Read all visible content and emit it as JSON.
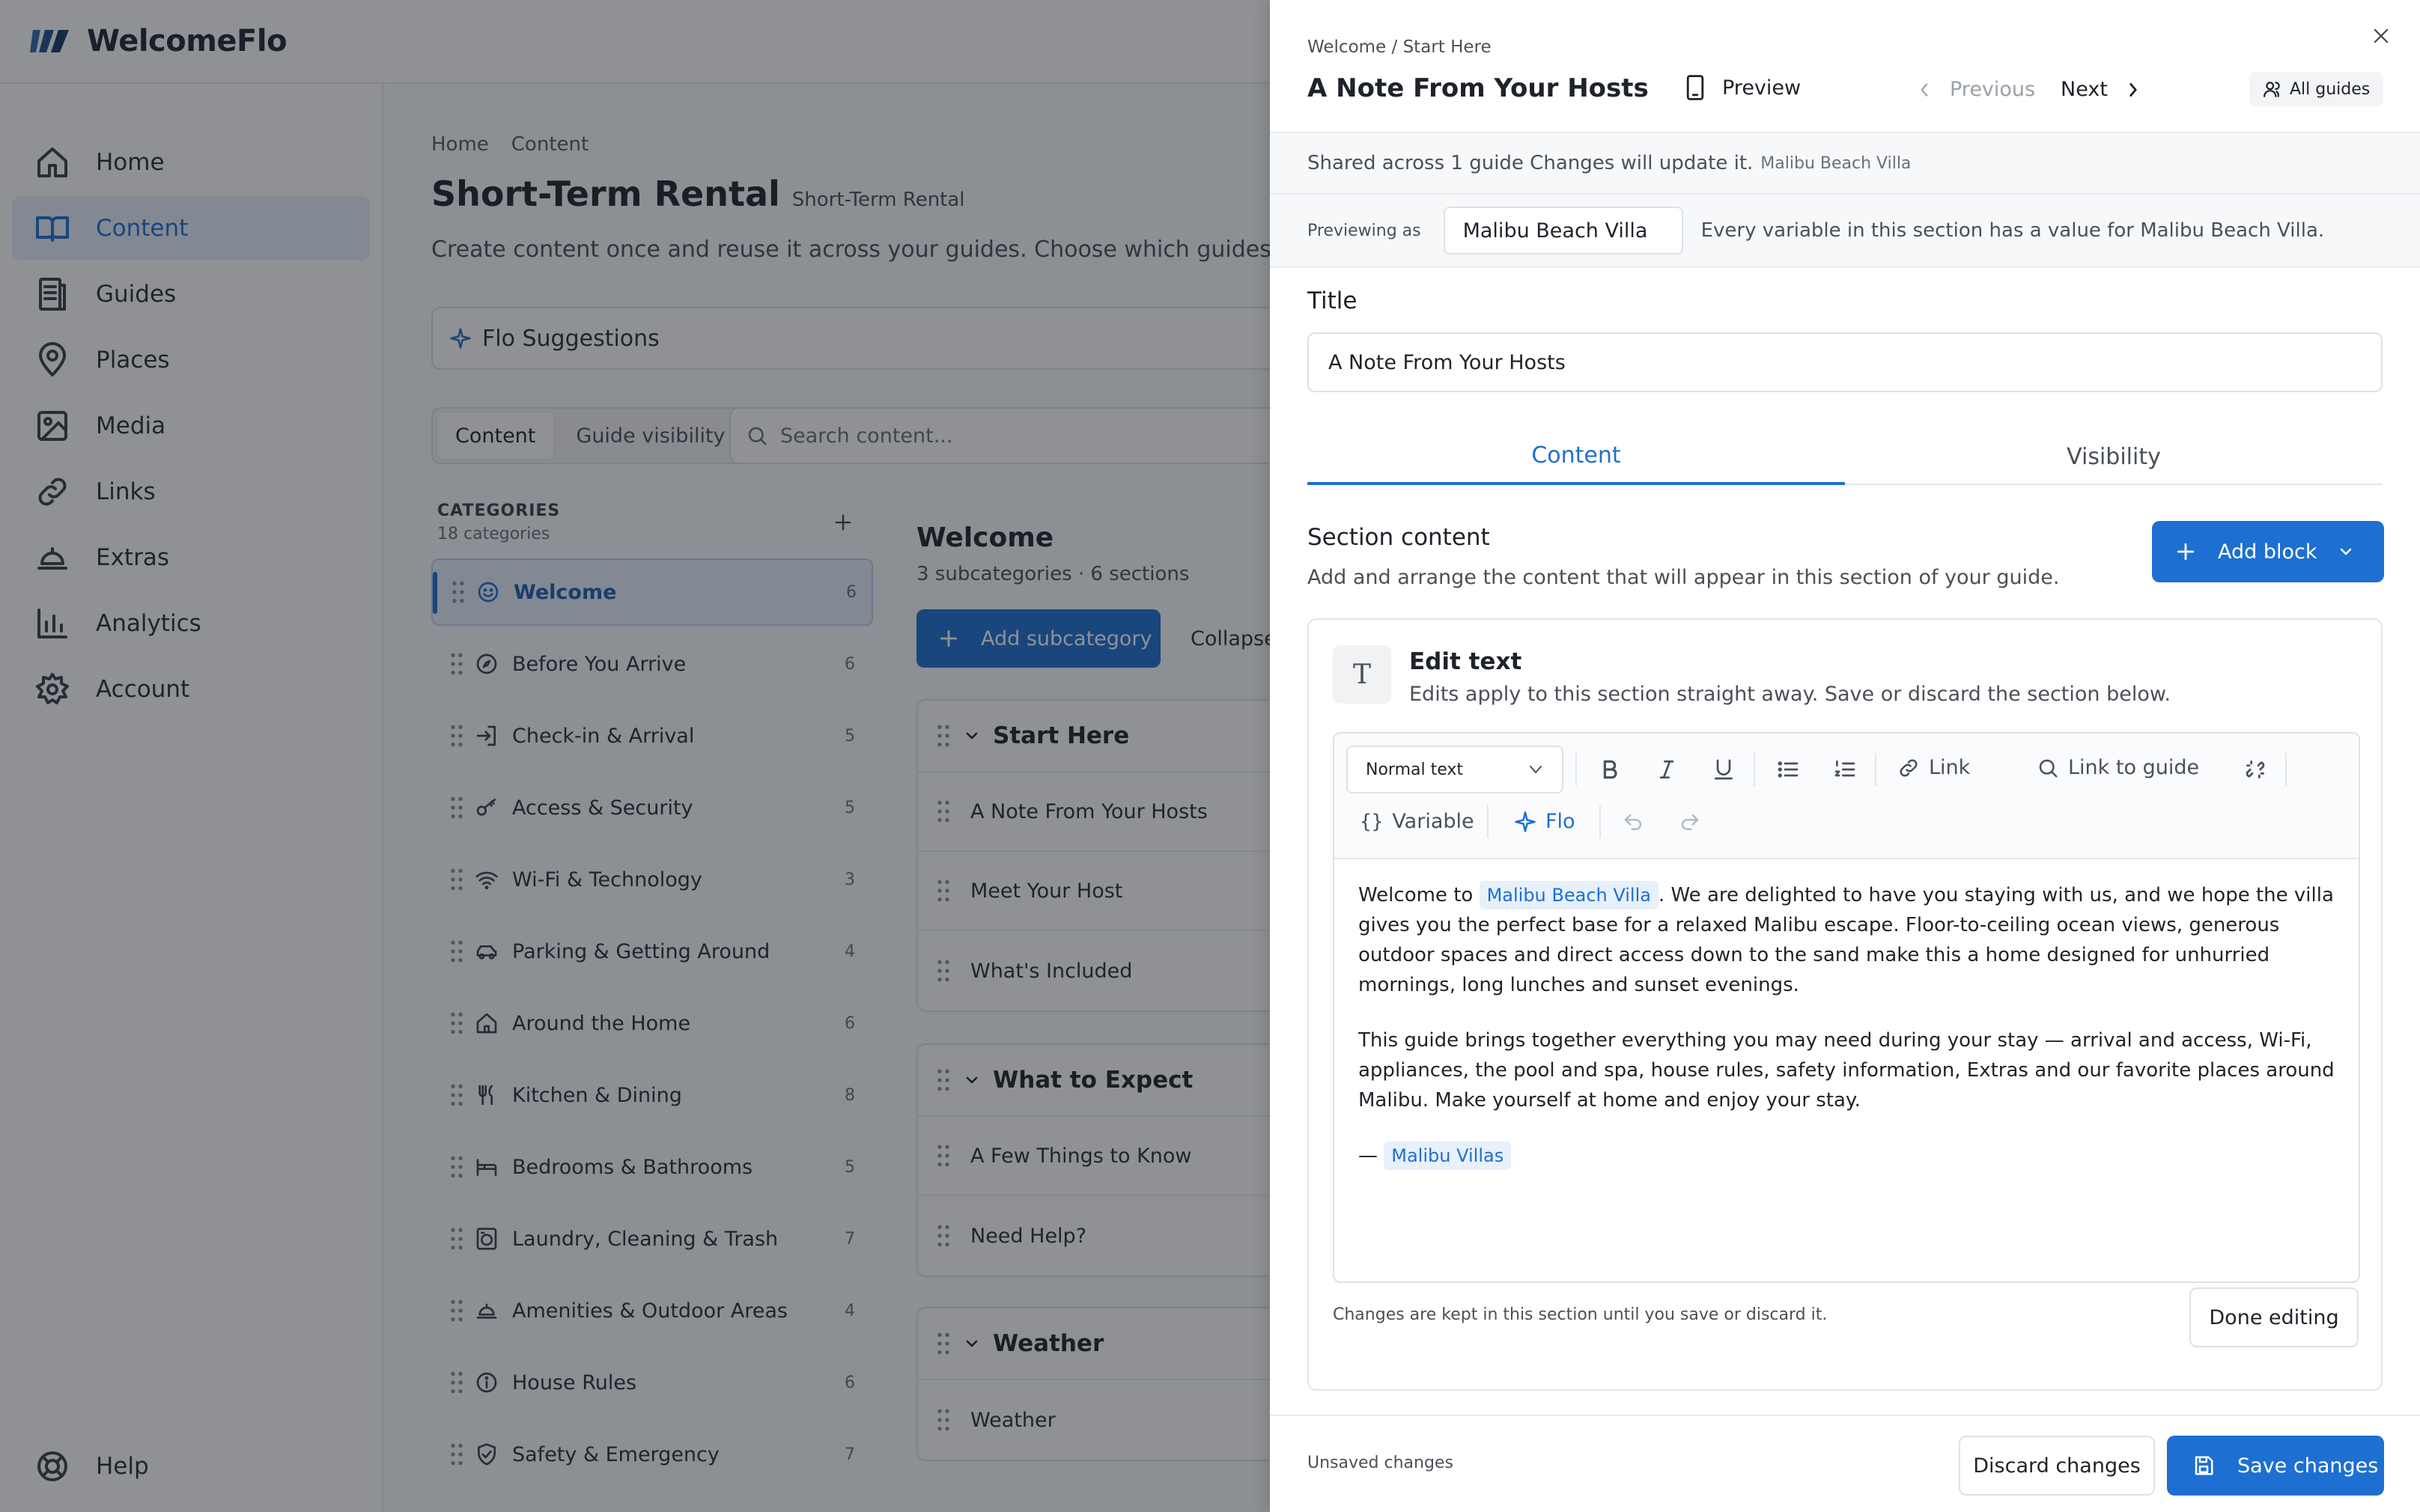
{
  "app": {
    "brand": "WelcomeFlo",
    "accent": "#1d6fd1"
  },
  "nav": {
    "items": [
      {
        "label": "Home",
        "icon": "home-icon"
      },
      {
        "label": "Content",
        "icon": "book-icon",
        "active": true
      },
      {
        "label": "Guides",
        "icon": "guides-icon"
      },
      {
        "label": "Places",
        "icon": "map-pin-icon"
      },
      {
        "label": "Media",
        "icon": "image-icon"
      },
      {
        "label": "Links",
        "icon": "link-icon"
      },
      {
        "label": "Extras",
        "icon": "bell-icon"
      },
      {
        "label": "Analytics",
        "icon": "bar-chart-icon"
      },
      {
        "label": "Account",
        "icon": "gear-icon"
      }
    ],
    "help": "Help"
  },
  "main": {
    "breadcrumb": [
      "Home",
      "Content"
    ],
    "title": "Short-Term Rental",
    "subtitle": "Short-Term Rental",
    "description": "Create content once and reuse it across your guides. Choose which guides can show",
    "flo_suggestions": "Flo Suggestions",
    "view_tabs": [
      "Content",
      "Guide visibility"
    ],
    "search_placeholder": "Search content...",
    "categories_heading": "CATEGORIES",
    "categories_count": "18 categories",
    "categories": [
      {
        "label": "Welcome",
        "count": "6",
        "icon": "smile-icon"
      },
      {
        "label": "Before You Arrive",
        "count": "6",
        "icon": "compass-icon"
      },
      {
        "label": "Check-in & Arrival",
        "count": "5",
        "icon": "login-icon"
      },
      {
        "label": "Access & Security",
        "count": "5",
        "icon": "key-icon"
      },
      {
        "label": "Wi-Fi & Technology",
        "count": "3",
        "icon": "wifi-icon"
      },
      {
        "label": "Parking & Getting Around",
        "count": "4",
        "icon": "car-icon"
      },
      {
        "label": "Around the Home",
        "count": "6",
        "icon": "house-icon"
      },
      {
        "label": "Kitchen & Dining",
        "count": "8",
        "icon": "utensils-icon"
      },
      {
        "label": "Bedrooms & Bathrooms",
        "count": "5",
        "icon": "bed-icon"
      },
      {
        "label": "Laundry, Cleaning & Trash",
        "count": "7",
        "icon": "washer-icon"
      },
      {
        "label": "Amenities & Outdoor Areas",
        "count": "4",
        "icon": "cloche-icon"
      },
      {
        "label": "House Rules",
        "count": "6",
        "icon": "info-icon"
      },
      {
        "label": "Safety & Emergency",
        "count": "7",
        "icon": "shield-icon"
      }
    ],
    "section_title": "Welcome",
    "section_sub": "3 subcategories · 6 sections",
    "add_subcategory": "Add subcategory",
    "collapse": "Collapse",
    "subcategories": [
      {
        "title": "Start Here",
        "rows": [
          "A Note From Your Hosts",
          "Meet Your Host",
          "What's Included"
        ]
      },
      {
        "title": "What to Expect",
        "rows": [
          "A Few Things to Know",
          "Need Help?"
        ]
      },
      {
        "title": "Weather",
        "rows": [
          "Weather"
        ]
      }
    ]
  },
  "drawer": {
    "breadcrumb": "Welcome / Start Here",
    "title": "A Note From Your Hosts",
    "preview": "Preview",
    "previous": "Previous",
    "next": "Next",
    "all_guides": "All guides",
    "shared_note": "Shared across 1 guide Changes will update it.",
    "shared_guide": "Malibu Beach Villa",
    "previewing_as_label": "Previewing as",
    "previewing_as_value": "Malibu Beach Villa",
    "variable_msg": "Every variable in this section has a value for Malibu Beach Villa.",
    "title_label": "Title",
    "title_value": "A Note From Your Hosts",
    "tabs": [
      "Content",
      "Visibility"
    ],
    "section_content_heading": "Section content",
    "section_content_desc": "Add and arrange the content that will appear in this section of your guide.",
    "add_block": "Add block",
    "edit_text_title": "Edit text",
    "edit_text_desc": "Edits apply to this section straight away. Save or discard the section below.",
    "format_select": "Normal text",
    "toolbar": {
      "link": "Link",
      "link_to_guide": "Link to guide",
      "variable": "Variable",
      "flo": "Flo"
    },
    "body": {
      "p1_before": "Welcome to",
      "p1_chip": "Malibu Beach Villa",
      "p1_after": ". We are delighted to have you staying with us, and we hope the villa gives you the perfect base for a relaxed Malibu escape. Floor-to-ceiling ocean views, generous outdoor spaces and direct access down to the sand make this a home designed for unhurried mornings, long lunches and sunset evenings.",
      "p2": "This guide brings together everything you may need during your stay — arrival and access, Wi-Fi, appliances, the pool and spa, house rules, safety information, Extras and our favorite places around Malibu. Make yourself at home and enjoy your stay.",
      "sign_dash": "—",
      "sign_chip": "Malibu Villas"
    },
    "footer_note": "Changes are kept in this section until you save or discard it.",
    "done_editing": "Done editing",
    "unsaved": "Unsaved changes",
    "discard": "Discard changes",
    "save": "Save changes"
  }
}
